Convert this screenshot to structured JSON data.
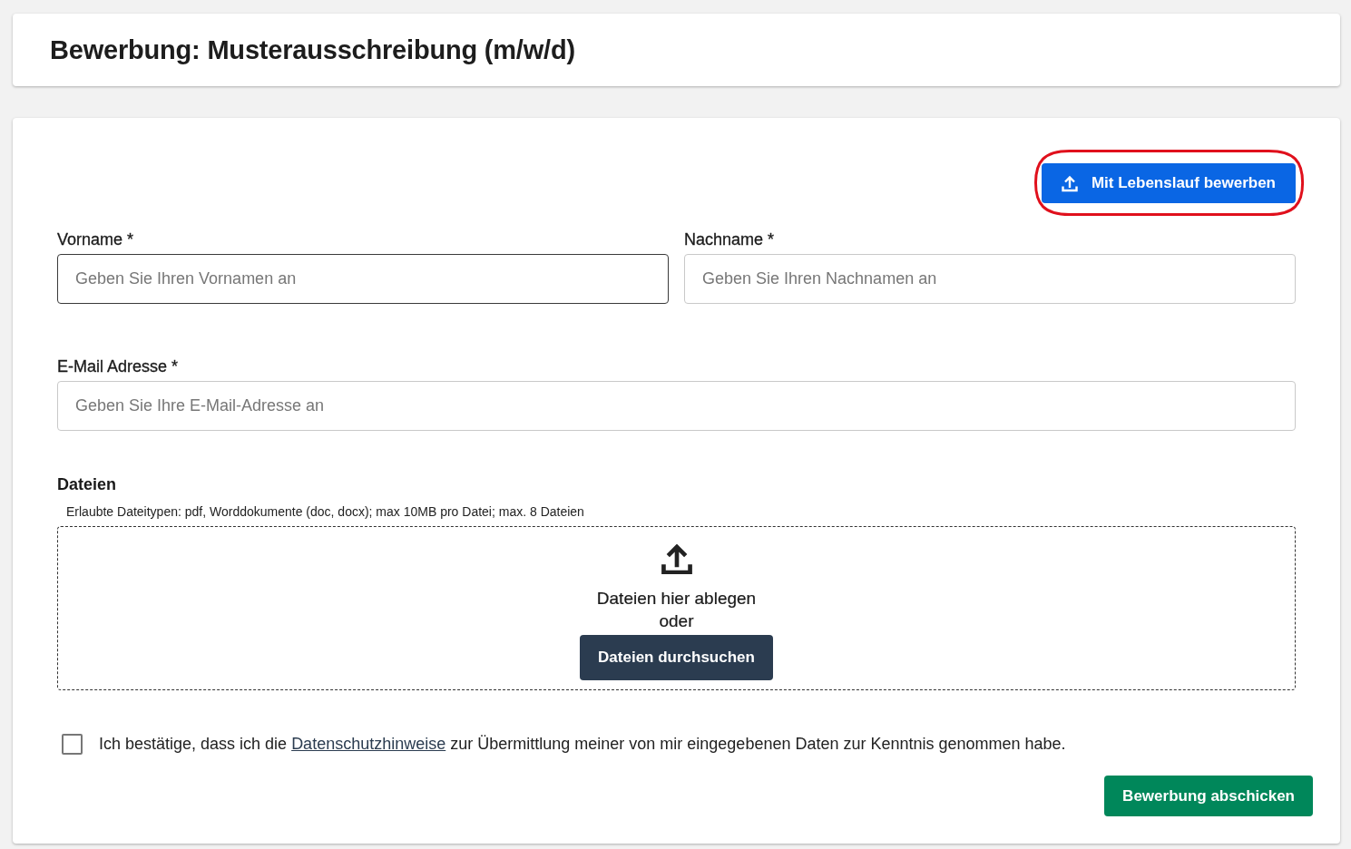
{
  "header": {
    "title": "Bewerbung: Musterausschreibung (m/w/d)"
  },
  "form": {
    "resume_button": {
      "label": "Mit Lebenslauf bewerben",
      "highlighted": true
    },
    "name_fields": [
      {
        "label": "Vorname *",
        "placeholder": "Geben Sie Ihren Vornamen an",
        "focused": true
      },
      {
        "label": "Nachname *",
        "placeholder": "Geben Sie Ihren Nachnamen an",
        "focused": false
      }
    ],
    "email_field": {
      "label": "E-Mail Adresse *",
      "placeholder": "Geben Sie Ihre E-Mail-Adresse an",
      "focused": false
    },
    "files": {
      "label": "Dateien",
      "hint": "Erlaubte Dateitypen: pdf, Worddokumente (doc, docx); max 10MB pro Datei; max. 8 Dateien",
      "drop_text": "Dateien hier ablegen",
      "or_text": "oder",
      "browse_button": "Dateien durchsuchen"
    },
    "consent": {
      "checked": false,
      "text_before": "Ich bestätige, dass ich die ",
      "link": "Datenschutzhinweise",
      "text_after": " zur Übermittlung meiner von mir eingegebenen Daten zur Kenntnis genommen habe."
    },
    "submit_button": "Bewerbung abschicken"
  }
}
